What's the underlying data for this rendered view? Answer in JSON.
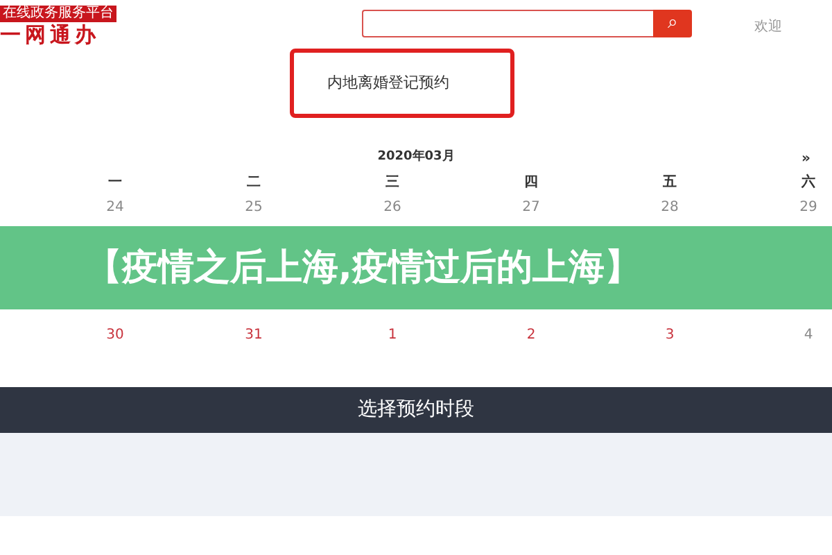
{
  "header": {
    "logo_badge": "在线政务服务平台",
    "logo_text": "一网通办",
    "search_button": "⌕",
    "welcome": "欢迎"
  },
  "service": {
    "title": "内地离婚登记预约"
  },
  "calendar": {
    "title": "2020年03月",
    "next": "»",
    "weekdays": [
      "一",
      "二",
      "三",
      "四",
      "五",
      "六"
    ],
    "weeks": [
      [
        {
          "day": "24",
          "available": false
        },
        {
          "day": "25",
          "available": false
        },
        {
          "day": "26",
          "available": false
        },
        {
          "day": "27",
          "available": false
        },
        {
          "day": "28",
          "available": false
        },
        {
          "day": "29",
          "available": false
        }
      ],
      [
        {
          "day": "30",
          "available": true
        },
        {
          "day": "31",
          "available": true
        },
        {
          "day": "1",
          "available": true
        },
        {
          "day": "2",
          "available": true
        },
        {
          "day": "3",
          "available": true
        },
        {
          "day": "4",
          "available": false
        }
      ]
    ]
  },
  "banner": {
    "text": "【疫情之后上海,疫情过后的上海】"
  },
  "time_section": {
    "title": "选择预约时段"
  }
}
